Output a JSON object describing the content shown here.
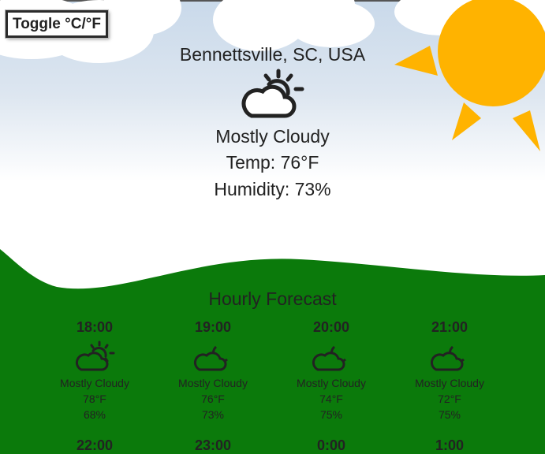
{
  "toggle_label": "Toggle °C/°F",
  "location": "Bennettsville, SC, USA",
  "current": {
    "icon": "partly-cloudy-sun-icon",
    "condition": "Mostly Cloudy",
    "temp": "Temp: 76°F",
    "humidity": "Humidity: 73%"
  },
  "forecast_title": "Hourly Forecast",
  "hourly": [
    {
      "time": "18:00",
      "icon": "cloud-sun-icon",
      "condition": "Mostly Cloudy",
      "temp": "78°F",
      "humidity": "68%"
    },
    {
      "time": "19:00",
      "icon": "cloud-moon-icon",
      "condition": "Mostly Cloudy",
      "temp": "76°F",
      "humidity": "73%"
    },
    {
      "time": "20:00",
      "icon": "cloud-moon-icon",
      "condition": "Mostly Cloudy",
      "temp": "74°F",
      "humidity": "75%"
    },
    {
      "time": "21:00",
      "icon": "cloud-moon-icon",
      "condition": "Mostly Cloudy",
      "temp": "72°F",
      "humidity": "75%"
    },
    {
      "time": "22:00"
    },
    {
      "time": "23:00"
    },
    {
      "time": "0:00"
    },
    {
      "time": "1:00"
    }
  ],
  "colors": {
    "sky_top": "#c9d9ea",
    "sun": "#ffb300",
    "grass": "#0b7a0b"
  }
}
